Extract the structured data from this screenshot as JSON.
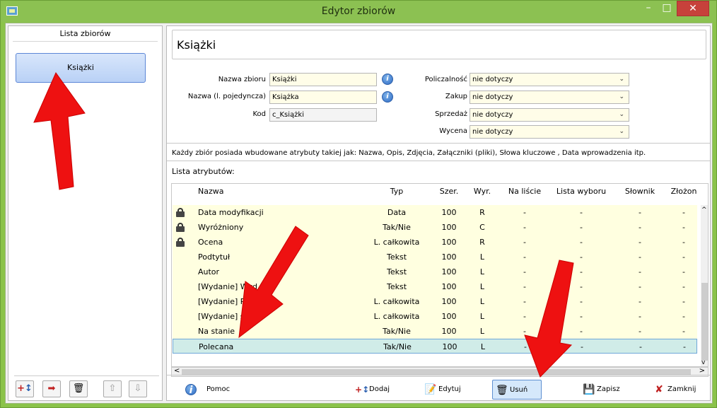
{
  "window": {
    "title": "Edytor zbiorów",
    "controls": {
      "minimize": "–",
      "maximize": "□",
      "close": "✕"
    }
  },
  "left": {
    "header": "Lista zbiorów",
    "items": [
      {
        "label": "Książki"
      }
    ],
    "tools": [
      "add-icon",
      "import-icon",
      "trash-icon",
      "arrow-up-icon",
      "arrow-down-icon"
    ]
  },
  "main": {
    "title": "Książki",
    "form": {
      "name_label": "Nazwa zbioru",
      "name_value": "Książki",
      "singular_label": "Nazwa (l. pojedyncza)",
      "singular_value": "Książka",
      "code_label": "Kod",
      "code_value": "c_Książki",
      "countability_label": "Policzalność",
      "countability_value": "nie dotyczy",
      "purchase_label": "Zakup",
      "purchase_value": "nie dotyczy",
      "sale_label": "Sprzedaż",
      "sale_value": "nie dotyczy",
      "valuation_label": "Wycena",
      "valuation_value": "nie dotyczy"
    },
    "note": "Każdy zbiór posiada wbudowane atrybuty takiej jak: Nazwa, Opis, Zdjęcia, Załączniki (pliki), Słowa kluczowe , Data wprowadzenia itp.",
    "list_label": "Lista atrybutów:",
    "columns": [
      "Nazwa",
      "Typ",
      "Szer.",
      "Wyr.",
      "Na liście",
      "Lista wyboru",
      "Słownik",
      "Złożon"
    ],
    "rows": [
      {
        "locked": true,
        "name": "Data modyfikacji",
        "type": "Data",
        "width": "100",
        "align": "R",
        "onlist": "-",
        "choice": "-",
        "dict": "-",
        "complex": "-"
      },
      {
        "locked": true,
        "name": "Wyróżniony",
        "type": "Tak/Nie",
        "width": "100",
        "align": "C",
        "onlist": "-",
        "choice": "-",
        "dict": "-",
        "complex": "-"
      },
      {
        "locked": true,
        "name": "Ocena",
        "type": "L. całkowita",
        "width": "100",
        "align": "R",
        "onlist": "-",
        "choice": "-",
        "dict": "-",
        "complex": "-"
      },
      {
        "locked": false,
        "name": "Podtytuł",
        "type": "Tekst",
        "width": "100",
        "align": "L",
        "onlist": "-",
        "choice": "-",
        "dict": "-",
        "complex": "-"
      },
      {
        "locked": false,
        "name": "Autor",
        "type": "Tekst",
        "width": "100",
        "align": "L",
        "onlist": "-",
        "choice": "-",
        "dict": "-",
        "complex": "-"
      },
      {
        "locked": false,
        "name": "[Wydanie] Wyd",
        "type": "Tekst",
        "width": "100",
        "align": "L",
        "onlist": "-",
        "choice": "-",
        "dict": "-",
        "complex": "-"
      },
      {
        "locked": false,
        "name": "[Wydanie] Ro",
        "type": "L. całkowita",
        "width": "100",
        "align": "L",
        "onlist": "-",
        "choice": "-",
        "dict": "-",
        "complex": "-"
      },
      {
        "locked": false,
        "name": "[Wydanie]            stron",
        "type": "L. całkowita",
        "width": "100",
        "align": "L",
        "onlist": "-",
        "choice": "-",
        "dict": "-",
        "complex": "-"
      },
      {
        "locked": false,
        "name": "Na stanie",
        "type": "Tak/Nie",
        "width": "100",
        "align": "L",
        "onlist": "-",
        "choice": "-",
        "dict": "-",
        "complex": "-"
      },
      {
        "locked": false,
        "name": "Polecana",
        "type": "Tak/Nie",
        "width": "100",
        "align": "L",
        "onlist": "-",
        "choice": "-",
        "dict": "-",
        "complex": "-",
        "selected": true
      }
    ],
    "buttons": {
      "help": "Pomoc",
      "add": "Dodaj",
      "edit": "Edytuj",
      "delete": "Usuń",
      "save": "Zapisz",
      "close": "Zamknij"
    }
  },
  "colors": {
    "frame": "#8cc152",
    "row_bg": "#ffffe0",
    "selected_row": "#d0ece8",
    "arrow": "#ee1111"
  }
}
